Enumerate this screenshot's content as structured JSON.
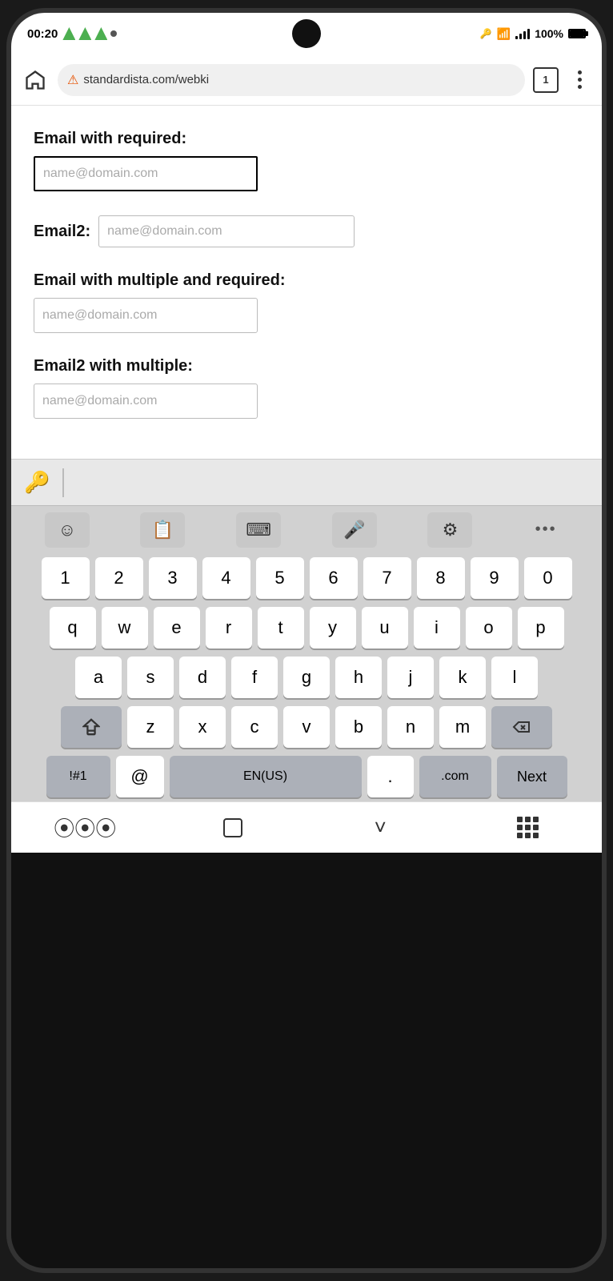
{
  "statusBar": {
    "time": "00:20",
    "battery": "100%",
    "url": "standardista.com/webki",
    "tabCount": "1"
  },
  "form": {
    "field1": {
      "label": "Email with required:",
      "placeholder": "name@domain.com",
      "borderStyle": "thick"
    },
    "field2": {
      "label": "Email2:",
      "placeholder": "name@domain.com",
      "borderStyle": "light"
    },
    "field3": {
      "label": "Email with multiple and required:",
      "placeholder": "name@domain.com",
      "borderStyle": "light"
    },
    "field4": {
      "label": "Email2 with multiple:",
      "placeholder": "name@domain.com",
      "borderStyle": "light"
    }
  },
  "keyboard": {
    "numbers": [
      "1",
      "2",
      "3",
      "4",
      "5",
      "6",
      "7",
      "8",
      "9",
      "0"
    ],
    "row1": [
      "q",
      "w",
      "e",
      "r",
      "t",
      "y",
      "u",
      "i",
      "o",
      "p"
    ],
    "row2": [
      "a",
      "s",
      "d",
      "f",
      "g",
      "h",
      "j",
      "k",
      "l"
    ],
    "row3": [
      "z",
      "x",
      "c",
      "v",
      "b",
      "n",
      "m"
    ],
    "bottomRow": {
      "special": "!#1",
      "at": "@",
      "space": "EN(US)",
      "dot": ".",
      "dotcom": ".com",
      "next": "Next"
    }
  }
}
